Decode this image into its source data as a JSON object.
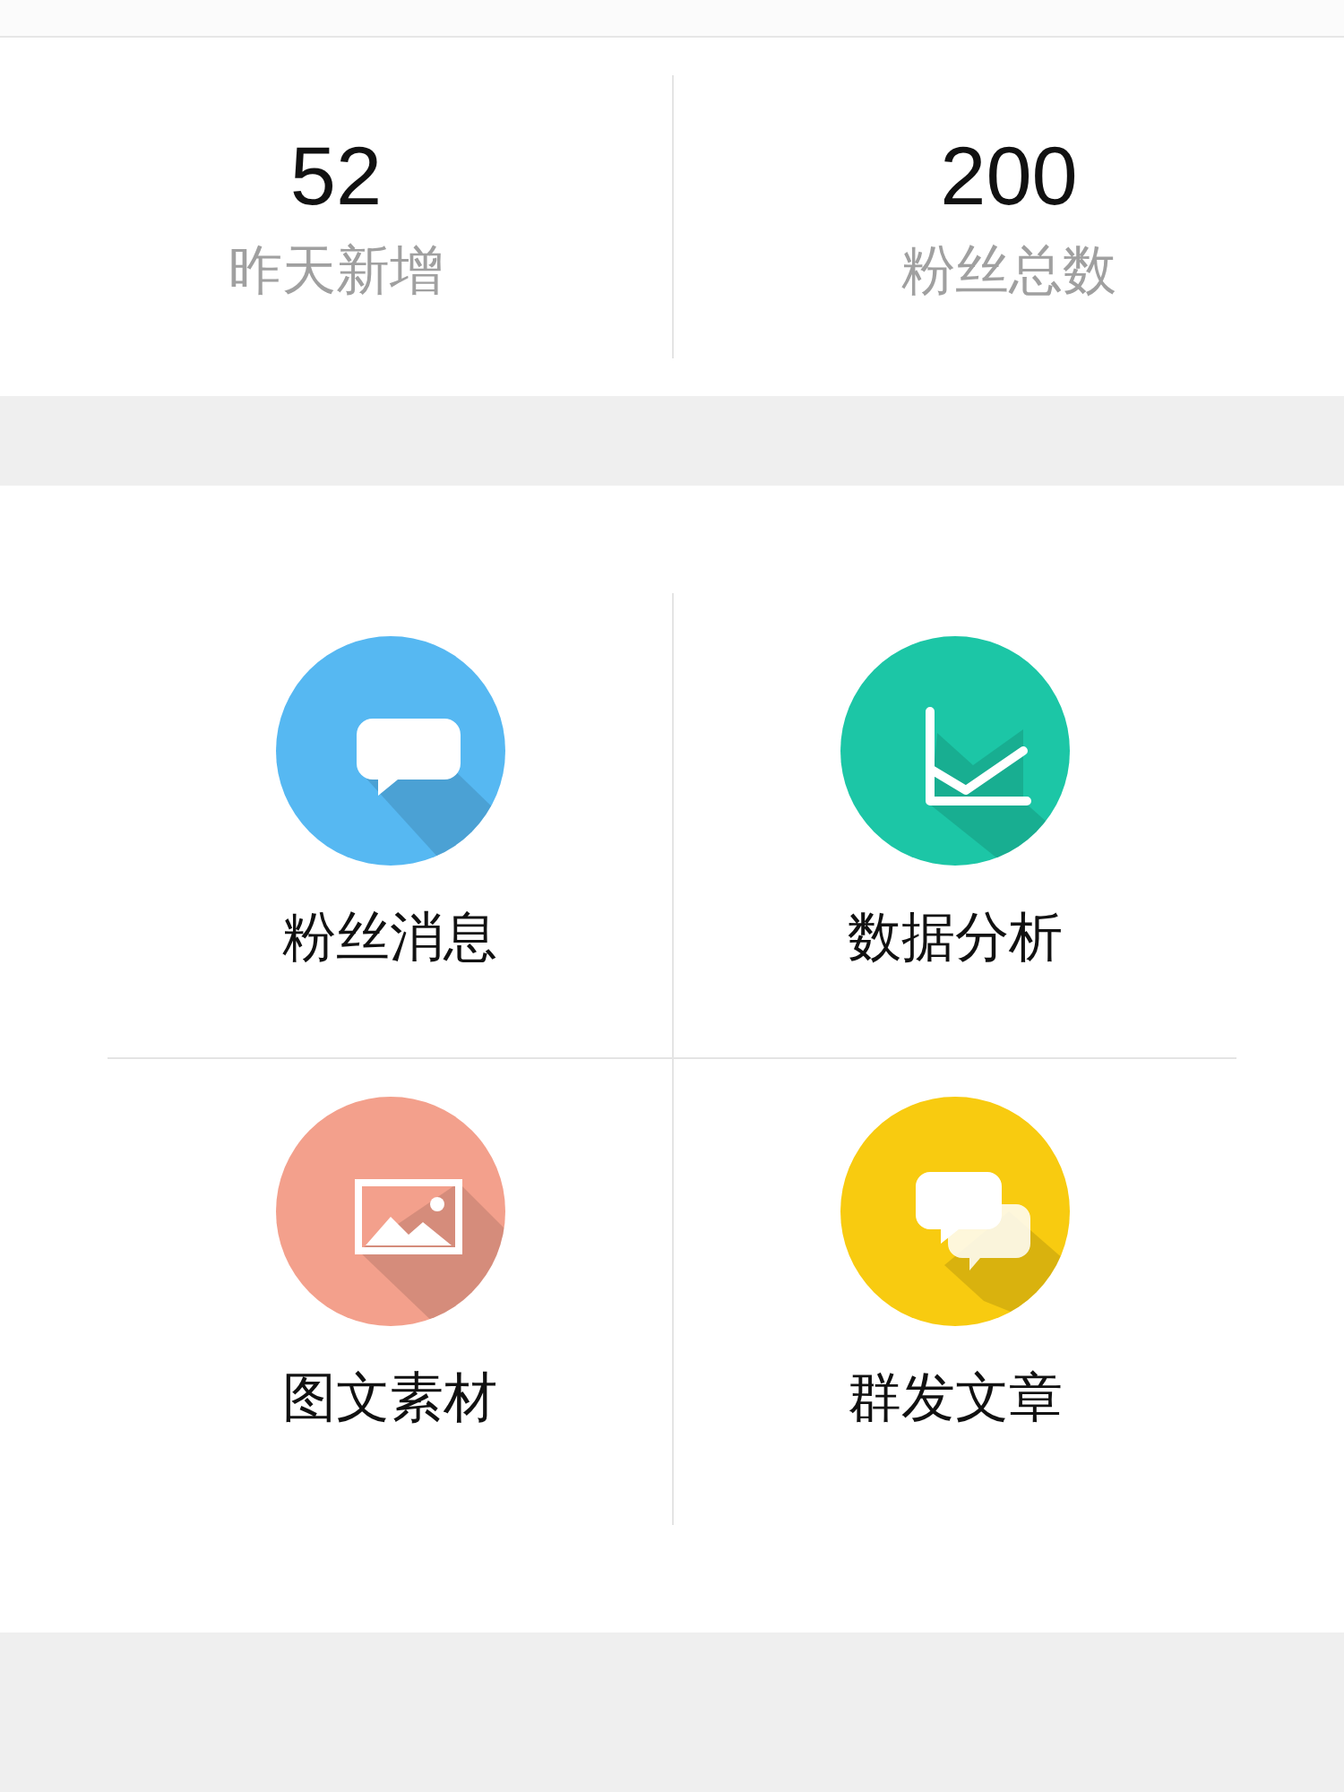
{
  "stats": [
    {
      "value": "52",
      "label": "昨天新增"
    },
    {
      "value": "200",
      "label": "粉丝总数"
    }
  ],
  "features": [
    {
      "kind": "message",
      "label": "粉丝消息",
      "color": "#56b8f2"
    },
    {
      "kind": "chart",
      "label": "数据分析",
      "color": "#1cc6a6"
    },
    {
      "kind": "image",
      "label": "图文素材",
      "color": "#f3a08c"
    },
    {
      "kind": "chat",
      "label": "群发文章",
      "color": "#f8cb10"
    }
  ]
}
